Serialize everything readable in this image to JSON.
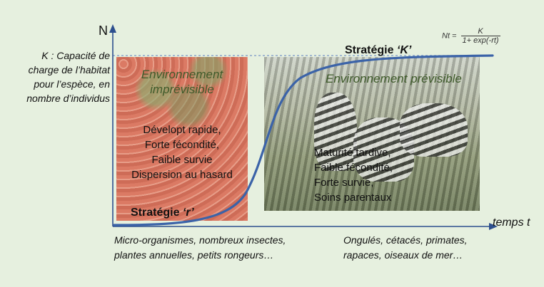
{
  "axes": {
    "y_label": "N",
    "x_label": "temps t"
  },
  "carrying_capacity_label": "K : Capacité de charge de l’habitat pour l’espèce, en nombre d’individus",
  "formula": {
    "lhs": "Nt =",
    "numerator": "K",
    "denominator": "1+ exp(-rt)"
  },
  "r_strategy": {
    "environment": [
      "Environnement",
      "imprévisible"
    ],
    "traits": [
      "Dévelopt rapide,",
      "Forte fécondité,",
      "Faible survie",
      "Dispersion au hasard"
    ],
    "title_prefix": "Stratégie ",
    "title_letter": "‘r’",
    "examples": [
      "Micro-organismes, nombreux insectes,",
      "plantes annuelles, petits rongeurs…"
    ]
  },
  "k_strategy": {
    "title_prefix": "Stratégie ",
    "title_letter": "‘K’",
    "environment": "Environnement prévisible",
    "traits": [
      "Maturité tardive,",
      "Faible fécondité,",
      "Forte survie,",
      "Soins parentaux"
    ],
    "examples": [
      "Ongulés, cétacés, primates,",
      "rapaces, oiseaux de mer…"
    ]
  },
  "colors": {
    "curve": "#3b63a8",
    "axes": "#2d4f8e",
    "k_line": "#7a96c6",
    "background": "#e6f0df"
  }
}
